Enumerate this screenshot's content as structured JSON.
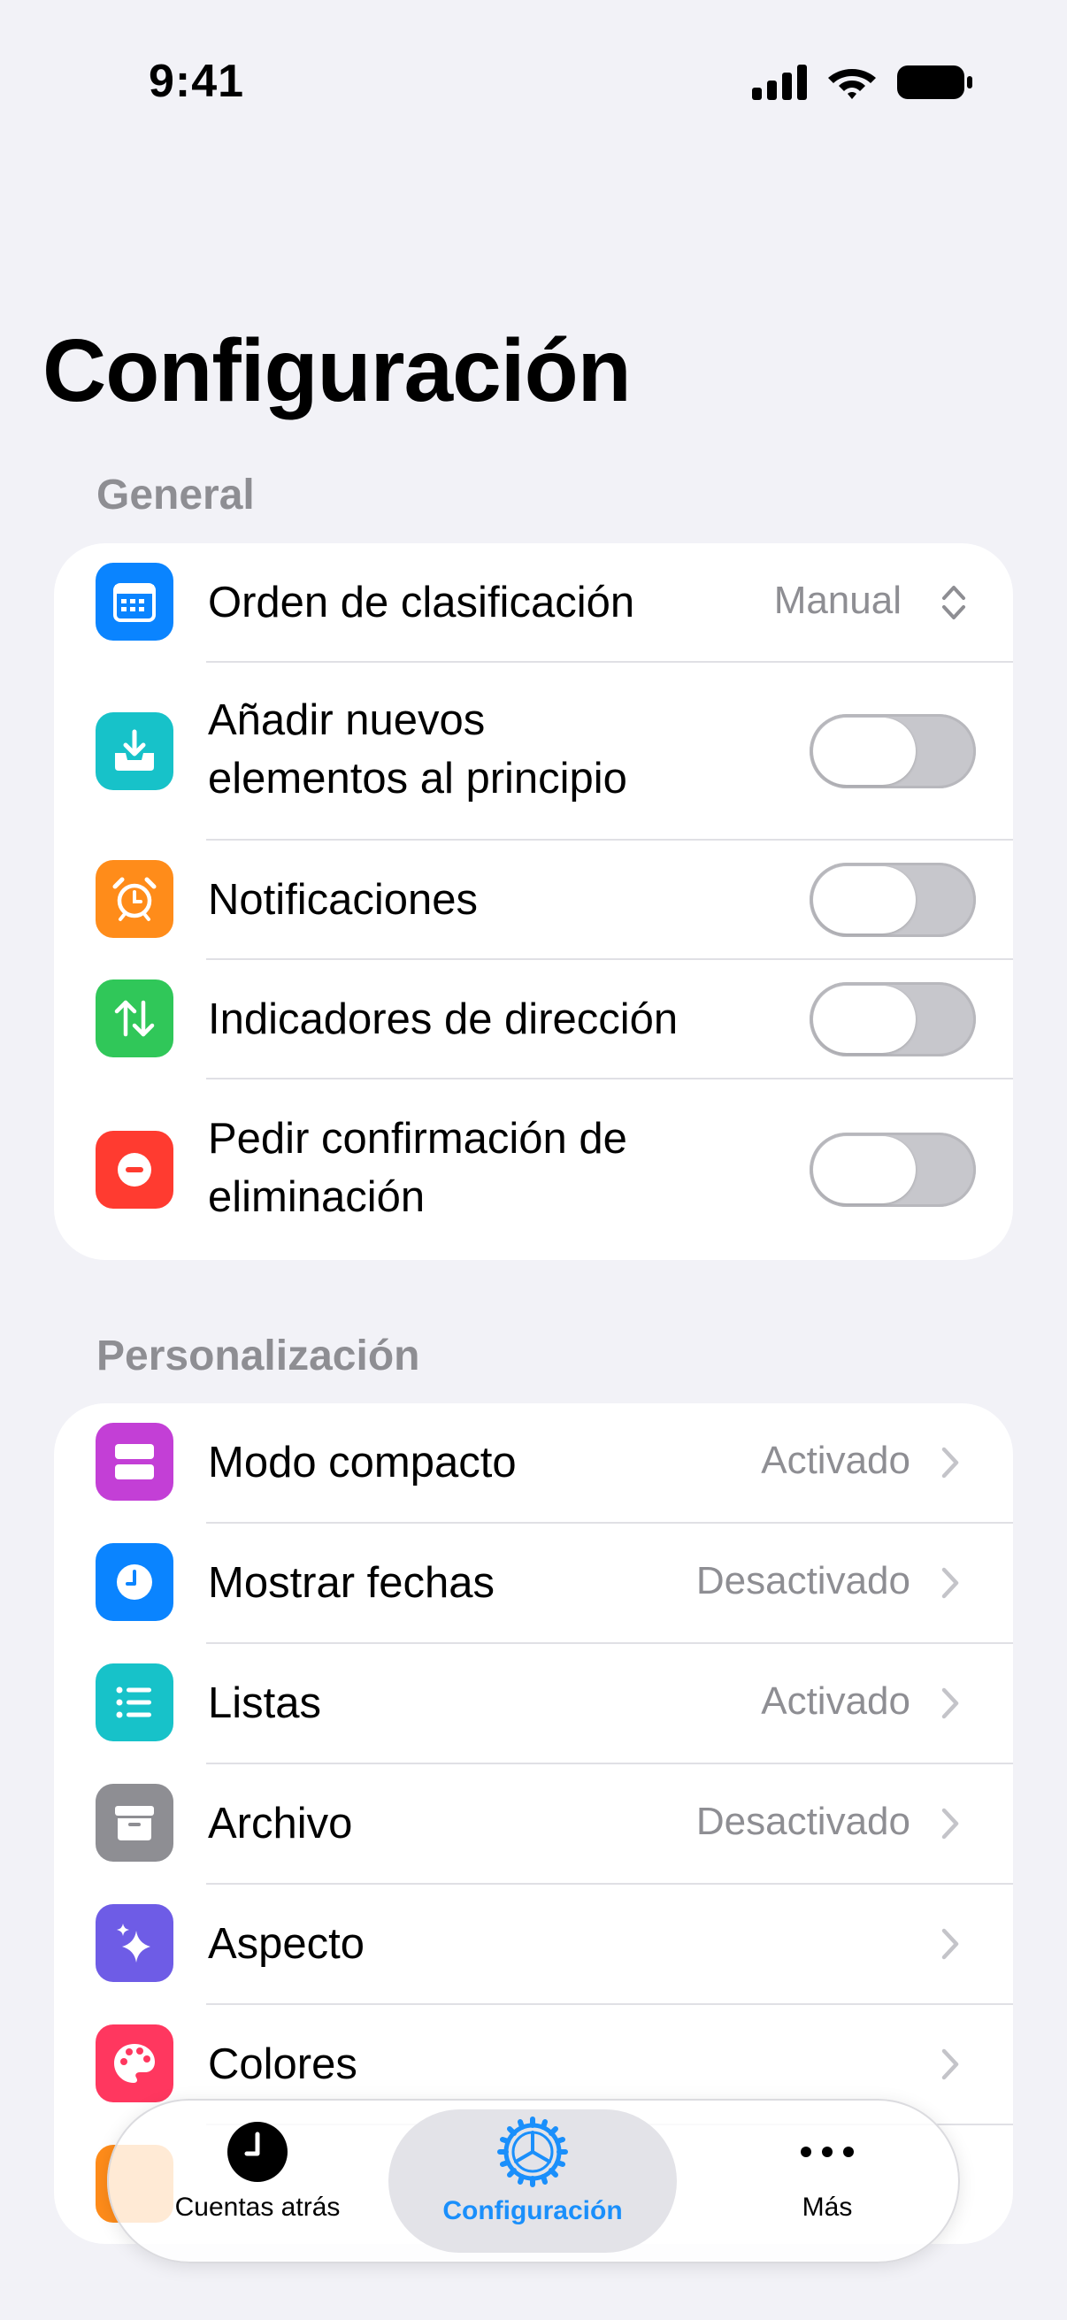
{
  "status_bar": {
    "time": "9:41"
  },
  "page": {
    "title": "Configuración"
  },
  "general": {
    "header": "General",
    "sort_order": {
      "label": "Orden de clasificación",
      "value": "Manual"
    },
    "add_top": {
      "label_line1": "Añadir nuevos",
      "label_line2": "elementos al principio",
      "on": false
    },
    "notifications": {
      "label": "Notificaciones",
      "on": false
    },
    "direction": {
      "label": "Indicadores de dirección",
      "on": false
    },
    "confirm_delete": {
      "label_line1": "Pedir confirmación de",
      "label_line2": "eliminación",
      "on": false
    }
  },
  "personalization": {
    "header": "Personalización",
    "items": [
      {
        "label": "Modo compacto",
        "value": "Activado",
        "color": "#c33fd6"
      },
      {
        "label": "Mostrar fechas",
        "value": "Desactivado",
        "color": "#0a84ff"
      },
      {
        "label": "Listas",
        "value": "Activado",
        "color": "#17c2c9"
      },
      {
        "label": "Archivo",
        "value": "Desactivado",
        "color": "#8e8e93"
      },
      {
        "label": "Aspecto",
        "value": "",
        "color": "#6e5ce6"
      },
      {
        "label": "Colores",
        "value": "",
        "color": "#ff375f"
      }
    ]
  },
  "tab_bar": {
    "tabs": [
      {
        "label": "Cuentas atrás",
        "active": false
      },
      {
        "label": "Configuración",
        "active": true
      },
      {
        "label": "Más",
        "active": false
      }
    ]
  },
  "colors": {
    "accent": "#1a8ffb",
    "calendar_icon": "#0a84ff",
    "tray_icon": "#17c2c9",
    "alarm_icon": "#ff8c1a",
    "arrows_icon": "#30c759",
    "minus_icon": "#ff3b30"
  }
}
